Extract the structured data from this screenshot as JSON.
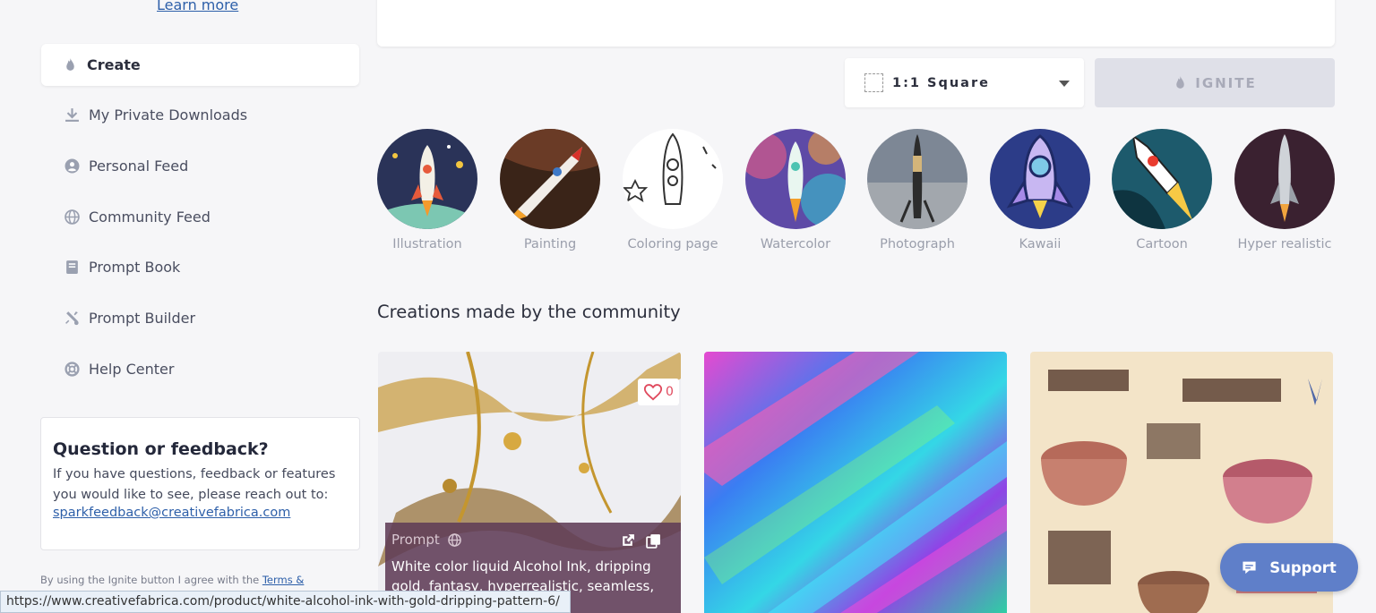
{
  "sidebar": {
    "learn_more": "Learn more",
    "active_item": "Create",
    "items": [
      {
        "label": "My Private Downloads",
        "icon": "download-icon"
      },
      {
        "label": "Personal Feed",
        "icon": "user-circle-icon"
      },
      {
        "label": "Community Feed",
        "icon": "globe-icon"
      },
      {
        "label": "Prompt Book",
        "icon": "book-icon"
      },
      {
        "label": "Prompt Builder",
        "icon": "tools-icon"
      },
      {
        "label": "Help Center",
        "icon": "lifebuoy-icon"
      }
    ],
    "feedback": {
      "title": "Question or feedback?",
      "text": "If you have questions, feedback or features you would like to see, please reach out to:",
      "email": "sparkfeedback@creativefabrica.com"
    },
    "terms_prefix": "By using the Ignite button I agree with the ",
    "terms_link": "Terms &"
  },
  "controls": {
    "ratio": "1:1 Square",
    "ignite": "IGNITE"
  },
  "styles": [
    {
      "label": "Illustration"
    },
    {
      "label": "Painting"
    },
    {
      "label": "Coloring page"
    },
    {
      "label": "Watercolor"
    },
    {
      "label": "Photograph"
    },
    {
      "label": "Kawaii"
    },
    {
      "label": "Cartoon"
    },
    {
      "label": "Hyper realistic"
    }
  ],
  "community": {
    "title": "Creations made by the community",
    "cards": [
      {
        "likes": "0",
        "prompt_label": "Prompt",
        "prompt_text": "White color liquid Alcohol Ink, dripping gold, fantasy, hyperrealistic, seamless, hyper detailed illustration"
      },
      {},
      {}
    ]
  },
  "status_url": "https://www.creativefabrica.com/product/white-alcohol-ink-with-gold-dripping-pattern-6/",
  "support_label": "Support",
  "colors": {
    "accent_blue": "#5f7fc9",
    "link": "#2d5fa9",
    "ignite_disabled": "#dfe0e8"
  }
}
